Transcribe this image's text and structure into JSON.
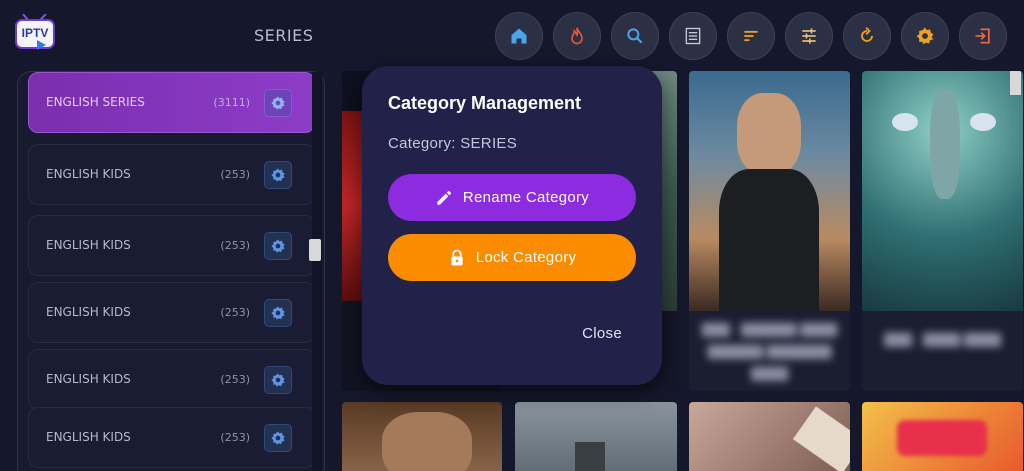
{
  "header": {
    "logo_text": "IPTV",
    "title": "SERIES",
    "tools": [
      {
        "icon": "home-icon",
        "name": "home-button"
      },
      {
        "icon": "flame-icon",
        "name": "trending-button"
      },
      {
        "icon": "search-icon",
        "name": "search-button"
      },
      {
        "icon": "list-icon",
        "name": "list-view-button"
      },
      {
        "icon": "sort-icon",
        "name": "sort-button"
      },
      {
        "icon": "filter-sliders-icon",
        "name": "filter-button"
      },
      {
        "icon": "refresh-icon",
        "name": "refresh-button"
      },
      {
        "icon": "gear-icon",
        "name": "settings-button"
      },
      {
        "icon": "logout-icon",
        "name": "logout-button"
      }
    ]
  },
  "categories": [
    {
      "name": "ENGLISH SERIES",
      "count": "(3111)",
      "active": true
    },
    {
      "name": "ENGLISH KIDS",
      "count": "(253)",
      "active": false
    },
    {
      "name": "ENGLISH KIDS",
      "count": "(253)",
      "active": false
    },
    {
      "name": "ENGLISH KIDS",
      "count": "(253)",
      "active": false
    },
    {
      "name": "ENGLISH KIDS",
      "count": "(253)",
      "active": false
    },
    {
      "name": "ENGLISH KIDS",
      "count": "(253)",
      "active": false
    }
  ],
  "modal": {
    "title": "Category Management",
    "subtitle": "Category: SERIES",
    "rename_label": "Rename Category",
    "lock_label": "Lock Category",
    "close_label": "Close"
  },
  "colors": {
    "accent_purple": "#8c2be0",
    "accent_orange": "#fb8c00",
    "modal_bg": "#21214a",
    "page_bg": "#15172c"
  }
}
